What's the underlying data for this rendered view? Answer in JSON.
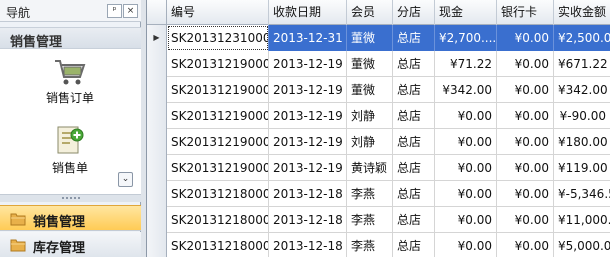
{
  "nav": {
    "title": "导航",
    "pin_label": "ᵖ",
    "close_label": "×",
    "group_title": "销售管理",
    "tiles": [
      {
        "label": "销售订单",
        "icon": "shopping-cart-icon"
      },
      {
        "label": "销售单",
        "icon": "document-add-icon"
      }
    ],
    "expand_label": "⌄",
    "groups": [
      {
        "label": "销售管理",
        "icon": "folder-icon",
        "active": true
      },
      {
        "label": "库存管理",
        "icon": "folder-icon",
        "active": false
      }
    ]
  },
  "grid": {
    "columns": [
      "编号",
      "收款日期",
      "会员",
      "分店",
      "现金",
      "银行卡",
      "实收金额"
    ],
    "rows": [
      {
        "indicator": "▶",
        "id": "SK201312310001",
        "date": "2013-12-31",
        "member": "董微",
        "branch": "总店",
        "cash": "¥2,700....",
        "card": "¥0.00",
        "received": "¥2,500.00",
        "selected": true
      },
      {
        "indicator": "",
        "id": "SK201312190005",
        "date": "2013-12-19",
        "member": "董微",
        "branch": "总店",
        "cash": "¥71.22",
        "card": "¥0.00",
        "received": "¥671.22",
        "selected": false
      },
      {
        "indicator": "",
        "id": "SK201312190004",
        "date": "2013-12-19",
        "member": "董微",
        "branch": "总店",
        "cash": "¥342.00",
        "card": "¥0.00",
        "received": "¥342.00",
        "selected": false
      },
      {
        "indicator": "",
        "id": "SK201312190003",
        "date": "2013-12-19",
        "member": "刘静",
        "branch": "总店",
        "cash": "¥0.00",
        "card": "¥0.00",
        "received": "¥-90.00",
        "selected": false
      },
      {
        "indicator": "",
        "id": "SK201312190002",
        "date": "2013-12-19",
        "member": "刘静",
        "branch": "总店",
        "cash": "¥0.00",
        "card": "¥0.00",
        "received": "¥180.00",
        "selected": false
      },
      {
        "indicator": "",
        "id": "SK201312190001",
        "date": "2013-12-19",
        "member": "黄诗颖",
        "branch": "总店",
        "cash": "¥0.00",
        "card": "¥0.00",
        "received": "¥119.00",
        "selected": false
      },
      {
        "indicator": "",
        "id": "SK201312180003",
        "date": "2013-12-18",
        "member": "李燕",
        "branch": "总店",
        "cash": "¥0.00",
        "card": "¥0.00",
        "received": "¥-5,346.50",
        "selected": false
      },
      {
        "indicator": "",
        "id": "SK201312180002",
        "date": "2013-12-18",
        "member": "李燕",
        "branch": "总店",
        "cash": "¥0.00",
        "card": "¥0.00",
        "received": "¥11,000....",
        "selected": false
      },
      {
        "indicator": "",
        "id": "SK201312180001",
        "date": "2013-12-18",
        "member": "李燕",
        "branch": "总店",
        "cash": "¥0.00",
        "card": "¥0.00",
        "received": "¥5,000.00",
        "selected": false
      }
    ]
  },
  "colors": {
    "selection": "#3a6fcf",
    "active_group": "#ffcb55"
  }
}
